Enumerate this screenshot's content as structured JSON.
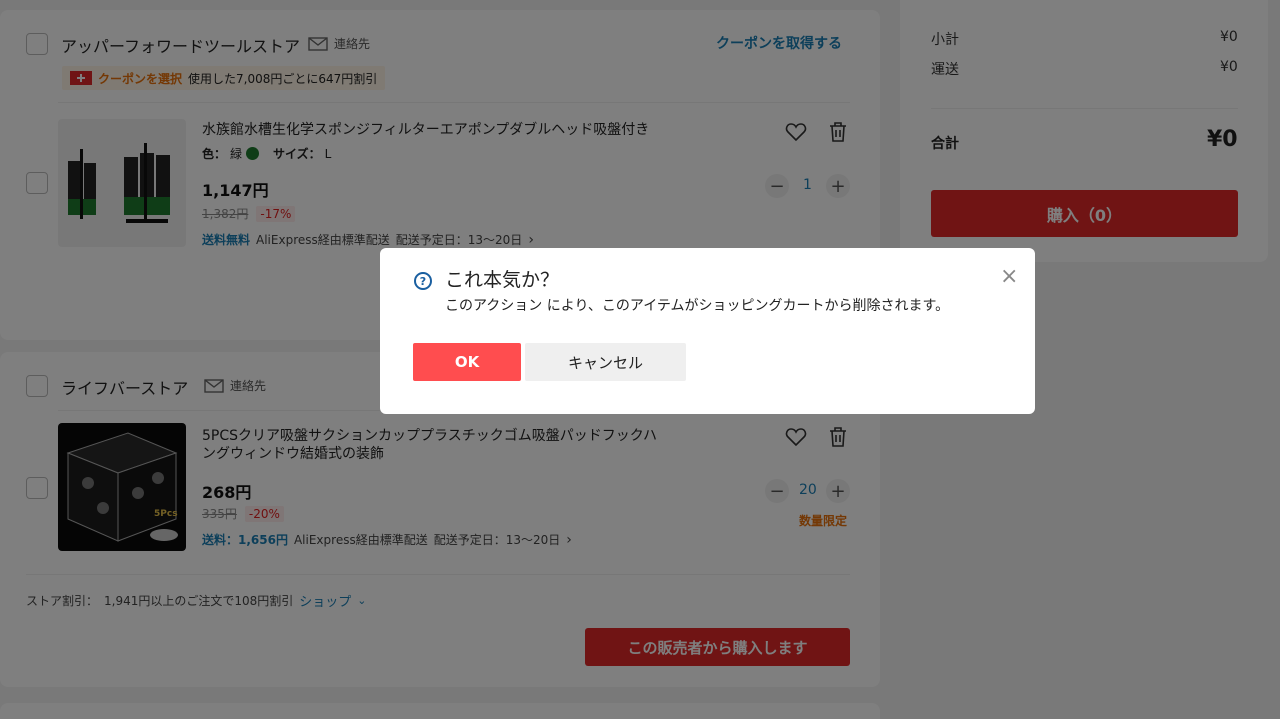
{
  "store1": {
    "name": "アッパーフォワードツールストア",
    "contact": "連絡先",
    "get_coupon": "クーポンを取得する",
    "coupon_select": "クーポンを選択",
    "coupon_text": "使用した7,008円ごとに647円割引",
    "item": {
      "title": "水族館水槽生化学スポンジフィルターエアポンプダブルヘッド吸盤付き",
      "color_label": "色：",
      "color_value": "緑",
      "size_label": "サイズ：",
      "size_value": "L",
      "price": "1,147円",
      "original_price": "1,382円",
      "discount": "-17%",
      "shipping_free": "送料無料",
      "shipping_method": "AliExpress経由標準配送",
      "delivery": "配送予定日：13～20日",
      "quantity": "1"
    }
  },
  "store2": {
    "name": "ライフバーストア",
    "contact": "連絡先",
    "item": {
      "title_line1": "5PCSクリア吸盤サクションカッププラスチックゴム吸盤パッドフックハ",
      "title_line2": "ングウィンドウ結婚式の装飾",
      "price": "268円",
      "original_price": "335円",
      "discount": "-20%",
      "shipping_label": "送料：1,656円",
      "shipping_method": "AliExpress経由標準配送",
      "delivery": "配送予定日：13～20日",
      "quantity": "20",
      "limit": "数量限定",
      "image_badge": "5Pcs"
    },
    "store_discount_label": "ストア割引：",
    "store_discount_text": "1,941円以上のご注文で108円割引",
    "shop_link": "ショップ",
    "buy_from_seller": "この販売者から購入します"
  },
  "summary": {
    "subtotal_label": "小計",
    "subtotal_value": "¥0",
    "shipping_label": "運送",
    "shipping_value": "¥0",
    "total_label": "合計",
    "total_value": "¥0",
    "buy_button": "購入（0）"
  },
  "modal": {
    "title": "これ本気か？",
    "message": "このアクション により、このアイテムがショッピングカートから削除されます。",
    "ok": "OK",
    "cancel": "キャンセル"
  },
  "colors": {
    "accent_red": "#e02828",
    "link_blue": "#1a7fb5",
    "ok_red": "#ff4d4f",
    "product_green": "#1f7a2e"
  }
}
